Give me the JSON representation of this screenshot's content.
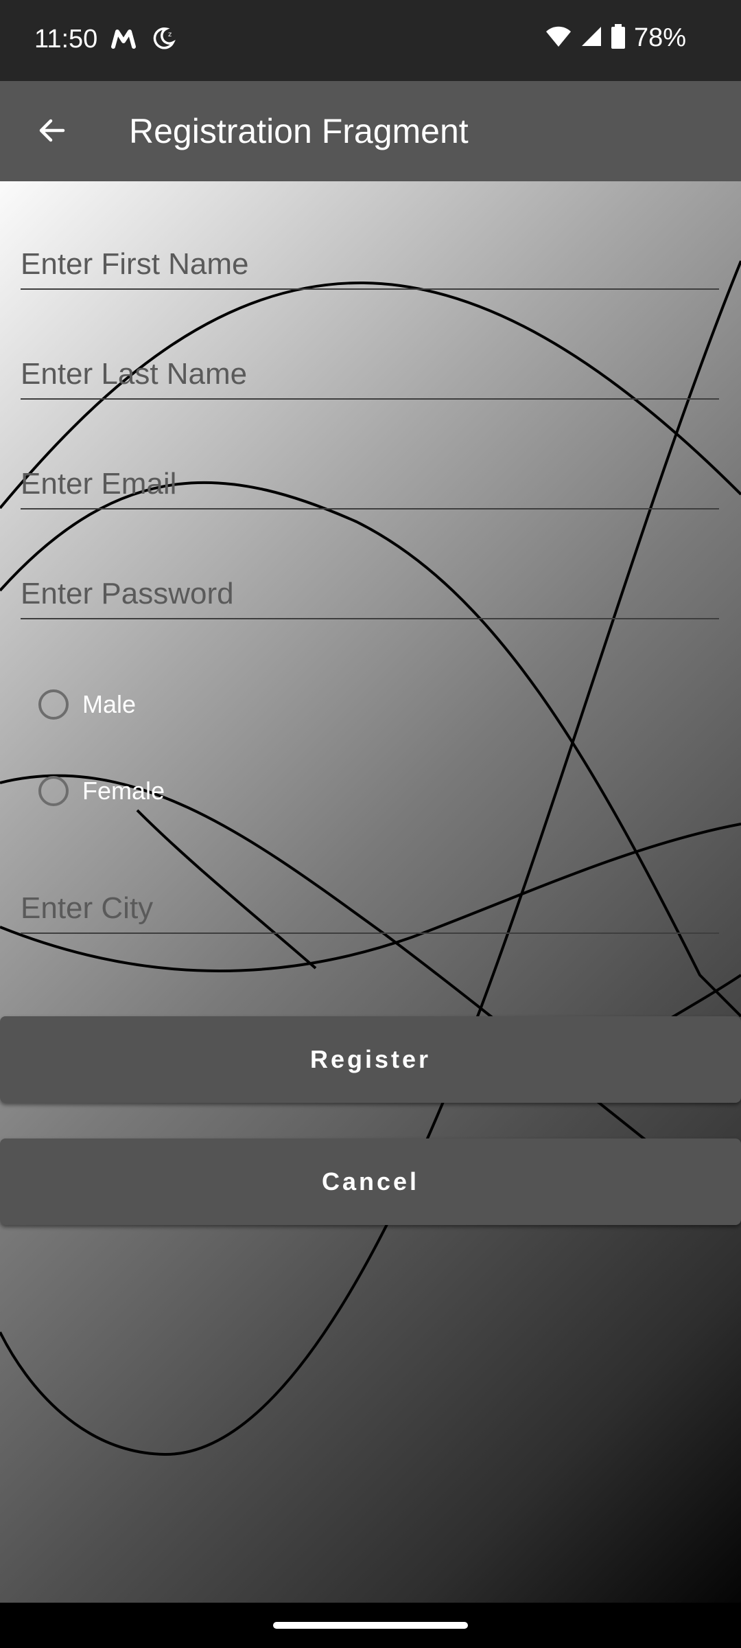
{
  "status_bar": {
    "time": "11:50",
    "battery_percent": "78%",
    "icons": [
      "gmail-m-icon",
      "moon-icon",
      "wifi-icon",
      "signal-icon",
      "battery-icon"
    ]
  },
  "app_bar": {
    "title": "Registration Fragment",
    "back_icon": "arrow-left-icon"
  },
  "form": {
    "first_name": {
      "placeholder": "Enter First Name",
      "value": ""
    },
    "last_name": {
      "placeholder": "Enter Last Name",
      "value": ""
    },
    "email": {
      "placeholder": "Enter Email",
      "value": ""
    },
    "password": {
      "placeholder": "Enter Password",
      "value": ""
    },
    "gender": {
      "options": [
        {
          "label": "Male",
          "checked": false
        },
        {
          "label": "Female",
          "checked": false
        }
      ]
    },
    "city": {
      "placeholder": "Enter City",
      "value": ""
    }
  },
  "buttons": {
    "register": "Register",
    "cancel": "Cancel"
  },
  "colors": {
    "status_bar": "#262626",
    "app_bar": "#565656",
    "button": "#545454"
  }
}
